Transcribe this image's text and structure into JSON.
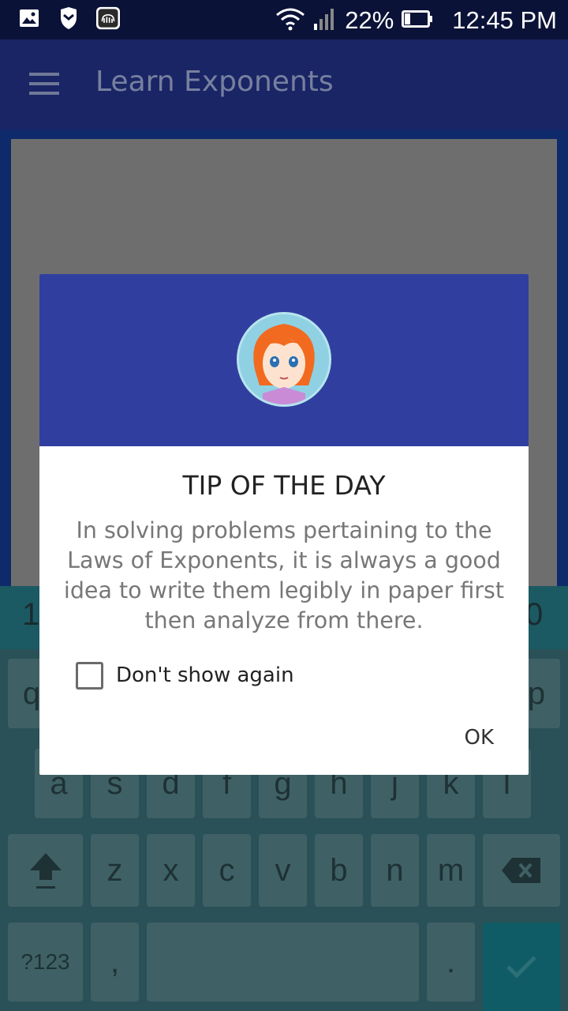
{
  "status_bar": {
    "left_icons": [
      "gallery-icon",
      "shield-icon",
      "soundcloud-icon"
    ],
    "battery_percent": "22%",
    "time": "12:45 PM"
  },
  "app_bar": {
    "title": "Learn Exponents",
    "menu_icon": "hamburger-menu-icon"
  },
  "dialog": {
    "title": "TIP OF THE DAY",
    "message": "In solving problems pertaining to the Laws of Exponents, it is always a good idea to write them legibly in paper first then analyze from there.",
    "checkbox_label": "Don't show again",
    "checkbox_checked": false,
    "ok_label": "OK",
    "header_color": "#303f9f"
  },
  "keyboard": {
    "number_row": [
      "1",
      "0"
    ],
    "row1": [
      "q",
      "p"
    ],
    "row2": [
      "a",
      "s",
      "d",
      "f",
      "g",
      "h",
      "j",
      "k",
      "l"
    ],
    "row3": [
      "z",
      "x",
      "c",
      "v",
      "b",
      "n",
      "m"
    ],
    "symbols_key": "?123",
    "comma_key": ",",
    "period_key": "."
  }
}
